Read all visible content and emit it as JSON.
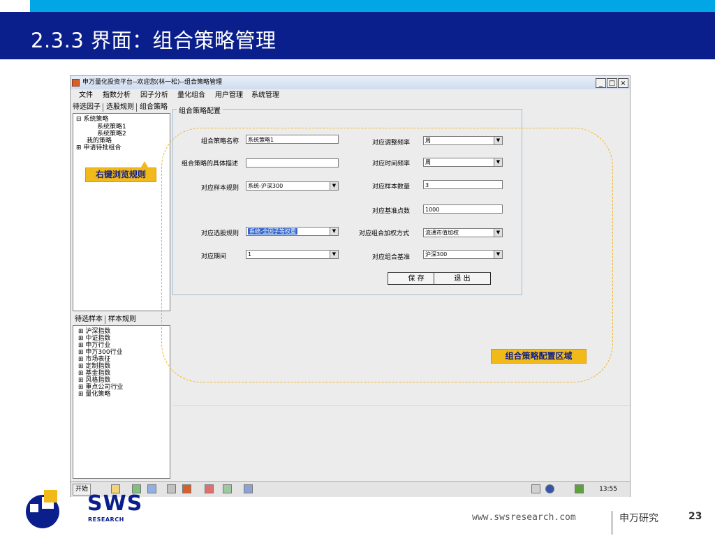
{
  "slide": {
    "title": "2.3.3 界面：组合策略管理"
  },
  "window": {
    "title": "申万量化投资平台--欢迎您(林一松)--组合策略管理",
    "btn_min": "_",
    "btn_max": "□",
    "btn_close": "×"
  },
  "menu": [
    "文件",
    "指数分析",
    "因子分析",
    "量化组合",
    "用户管理",
    "系统管理"
  ],
  "left_tabs": [
    "待选因子",
    "选股规则",
    "组合策略"
  ],
  "tree1": [
    "⊟ 系统策略",
    "系统策略1",
    "系统策略2",
    "我的策略",
    "⊞ 申请待批组合"
  ],
  "callout_left": "右键浏览规则",
  "left_tabs2": [
    "待选样本",
    "样本规则"
  ],
  "tree2": [
    "⊞ 沪深指数",
    "⊞ 中证指数",
    "⊞ 申万行业",
    "⊞ 申万300行业",
    "⊞ 市场表征",
    "⊞ 定制指数",
    "⊞ 基金指数",
    "⊞ 风格指数",
    "⊞ 重点公司行业",
    "⊞ 量化策略"
  ],
  "panel": {
    "title": "组合策略配置",
    "labels": {
      "name": "组合策略名称",
      "desc": "组合策略的具体描述",
      "sample_rule": "对应样本规则",
      "stock_rule": "对应选股规则",
      "period": "对应期间",
      "adj_freq": "对应调整频率",
      "time_freq": "对应时间频率",
      "sample_count": "对应样本数量",
      "base_point": "对应基准点数",
      "weight_method": "对应组合加权方式",
      "benchmark": "对应组合基准"
    },
    "values": {
      "name": "系统策略1",
      "desc": "",
      "sample_rule": "系统-沪深300",
      "stock_rule": "系统-全因子等权重",
      "period": "1",
      "adj_freq": "周",
      "time_freq": "周",
      "sample_count": "3",
      "base_point": "1000",
      "weight_method": "流通市值加权",
      "benchmark": "沪深300"
    },
    "save_button": "保 存",
    "exit_button": "退 出"
  },
  "callout_right": "组合策略配置区域",
  "taskbar": {
    "start": "开始",
    "time": "13:55"
  },
  "footer": {
    "url": "www.swsresearch.com",
    "company": "申万研究",
    "page": "23",
    "logo_text": "SWS",
    "logo_sub": "RESEARCH"
  },
  "colors": {
    "header_bg": "#0b1f8c",
    "accent_cyan": "#00a6e6",
    "callout": "#f2b91b"
  }
}
